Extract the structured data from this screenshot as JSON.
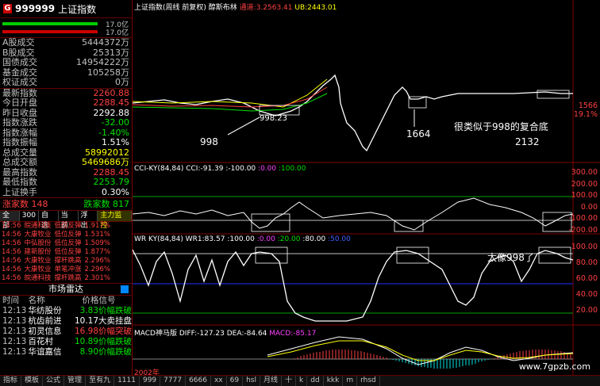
{
  "header": {
    "badge": "G",
    "code": "999999",
    "name": "上证指数"
  },
  "bars": {
    "b1": "17.0亿",
    "b2": "17.0亿"
  },
  "volumes": [
    {
      "label": "A股成交",
      "value": "5444372万"
    },
    {
      "label": "B股成交",
      "value": "25313万"
    },
    {
      "label": "国债成交",
      "value": "14954222万"
    },
    {
      "label": "基金成交",
      "value": "105258万"
    },
    {
      "label": "权证成交",
      "value": "0万"
    }
  ],
  "quotes": [
    {
      "label": "最新指数",
      "value": "2260.88",
      "color": "red"
    },
    {
      "label": "今日开盘",
      "value": "2288.45",
      "color": "red"
    },
    {
      "label": "昨日收盘",
      "value": "2292.88",
      "color": "wht"
    },
    {
      "label": "指数涨跌",
      "value": "-32.00",
      "color": "grn"
    },
    {
      "label": "指数涨幅",
      "value": "-1.40%",
      "color": "grn"
    },
    {
      "label": "指数振幅",
      "value": "1.51%",
      "color": "wht"
    },
    {
      "label": "总成交量",
      "value": "58992012",
      "color": "yel"
    },
    {
      "label": "总成交额",
      "value": "5469686万",
      "color": "yel"
    },
    {
      "label": "最高指数",
      "value": "2288.45",
      "color": "red"
    },
    {
      "label": "最低指数",
      "value": "2253.79",
      "color": "grn"
    },
    {
      "label": "上证换手",
      "value": "0.30%",
      "color": "wht"
    }
  ],
  "updown": {
    "up_label": "涨家数",
    "up": "148",
    "down_label": "跌家数",
    "down": "817"
  },
  "tabs": [
    "全部",
    "300",
    "自选",
    "当前",
    "浮出",
    "主力监控"
  ],
  "alerts": [
    {
      "time": "14:56",
      "name": "皖通科技",
      "type": "低位反弹",
      "pct": "1.917%"
    },
    {
      "time": "14:56",
      "name": "大康牧业",
      "type": "低位反弹",
      "pct": "1.531%"
    },
    {
      "time": "14:56",
      "name": "中弘股份",
      "type": "低位反弹",
      "pct": "1.509%"
    },
    {
      "time": "14:56",
      "name": "建新股份",
      "type": "低位反弹",
      "pct": "1.877%"
    },
    {
      "time": "14:56",
      "name": "大康牧业",
      "type": "撑杆跳高",
      "pct": "2.296%"
    },
    {
      "time": "14:56",
      "name": "大康牧业",
      "type": "单笔冲涨",
      "pct": "2.296%"
    },
    {
      "time": "14:56",
      "name": "皖通科技",
      "type": "撑杆跳高",
      "pct": "2.301%"
    }
  ],
  "radar": {
    "title": "市场雷达"
  },
  "table": {
    "headers": [
      "时间",
      "名称",
      "价格",
      "信号"
    ],
    "rows": [
      {
        "time": "12:13",
        "name": "华纺股份",
        "price": "3.83",
        "signal": "价幅跌破",
        "color": "grn"
      },
      {
        "time": "12:13",
        "name": "杭齿前进",
        "price": "10.17",
        "signal": "大卖挂盘",
        "color": "wht"
      },
      {
        "time": "12:13",
        "name": "初灵信息",
        "price": "16.98",
        "signal": "价幅突破",
        "color": "red"
      },
      {
        "time": "12:13",
        "name": "百花村",
        "price": "10.89",
        "signal": "价幅跌破",
        "color": "grn"
      },
      {
        "time": "12:13",
        "name": "华谊嘉信",
        "price": "8.90",
        "signal": "价幅跌破",
        "color": "grn"
      }
    ]
  },
  "panel1": {
    "title": "上证指数(周线 前复权)",
    "indicator": "醇斯布林",
    "up": "通道:3.2563.41",
    "ub": "UB:2443.01",
    "ax1": "1566",
    "ax2": "19.1%"
  },
  "panel2": {
    "title": "CCI-KY(84,84)",
    "cci": "CCI:-91.39",
    "v1": ":-100.00",
    "v2": ":0.00",
    "v3": ":100.00",
    "ax": [
      "300.00",
      "200.00",
      "100.00",
      "0.00",
      "-100.00",
      "-200.00"
    ]
  },
  "panel3": {
    "title": "WR KY(84,84)",
    "wr": "WR1:83.57",
    "v1": ":100.00",
    "v2": ":0.00",
    "v3": ":20.00",
    "v4": ":80.00",
    "v5": ":50.00",
    "ax": [
      "100.00",
      "80.00",
      "60.00",
      "40.00",
      "20.00"
    ]
  },
  "panel4": {
    "title": "MACD神马版",
    "diff": "DIFF:-127.23",
    "dea": "DEA:-84.64",
    "macd": "MACD:-85.17",
    "year": "2002年"
  },
  "annotations": {
    "a1": "998.23",
    "a2": "998",
    "a3": "1664",
    "a4": "很类似于998的复合底",
    "a5": "2132",
    "a6": "太像998了"
  },
  "watermark": "www.7gpzb.com",
  "bottom": [
    "指标",
    "模板",
    "公式",
    "管理",
    "至有九",
    "1111",
    "999",
    "7777",
    "6666",
    "xx",
    "69",
    "hsl",
    "月线",
    "十",
    "k",
    "dd",
    "kkk",
    "m",
    "rhsd"
  ]
}
